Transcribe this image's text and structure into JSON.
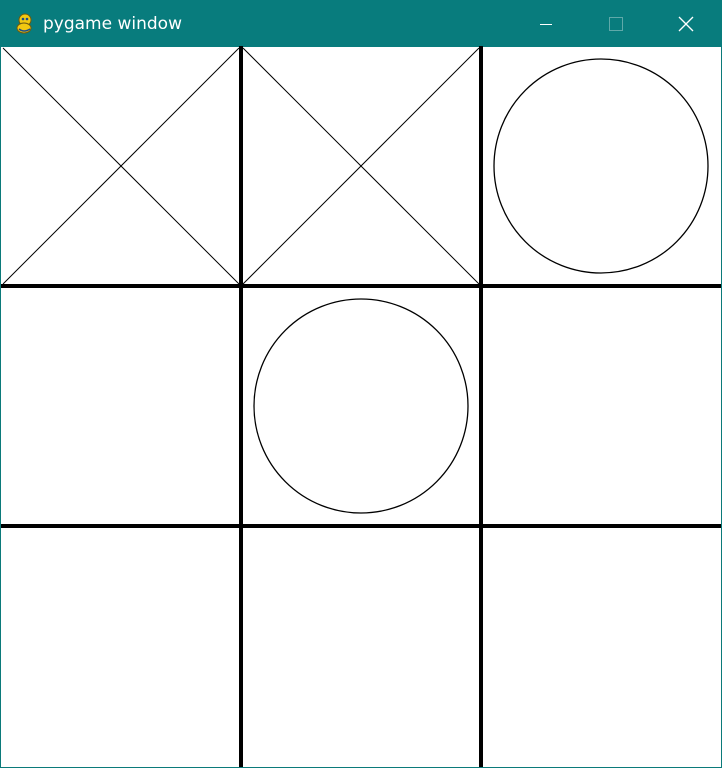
{
  "window": {
    "title": "pygame window",
    "app_icon": "pygame-snake-icon",
    "controls": {
      "minimize_icon": "minimize-icon",
      "maximize_icon": "maximize-icon",
      "close_icon": "close-icon"
    },
    "titlebar_color": "#087c7d"
  },
  "board": {
    "rows": 3,
    "cols": 3,
    "cells": [
      [
        "X",
        "X",
        "O"
      ],
      [
        "",
        "O",
        ""
      ],
      [
        "",
        "",
        ""
      ]
    ],
    "line_color": "#000000",
    "background": "#ffffff"
  }
}
